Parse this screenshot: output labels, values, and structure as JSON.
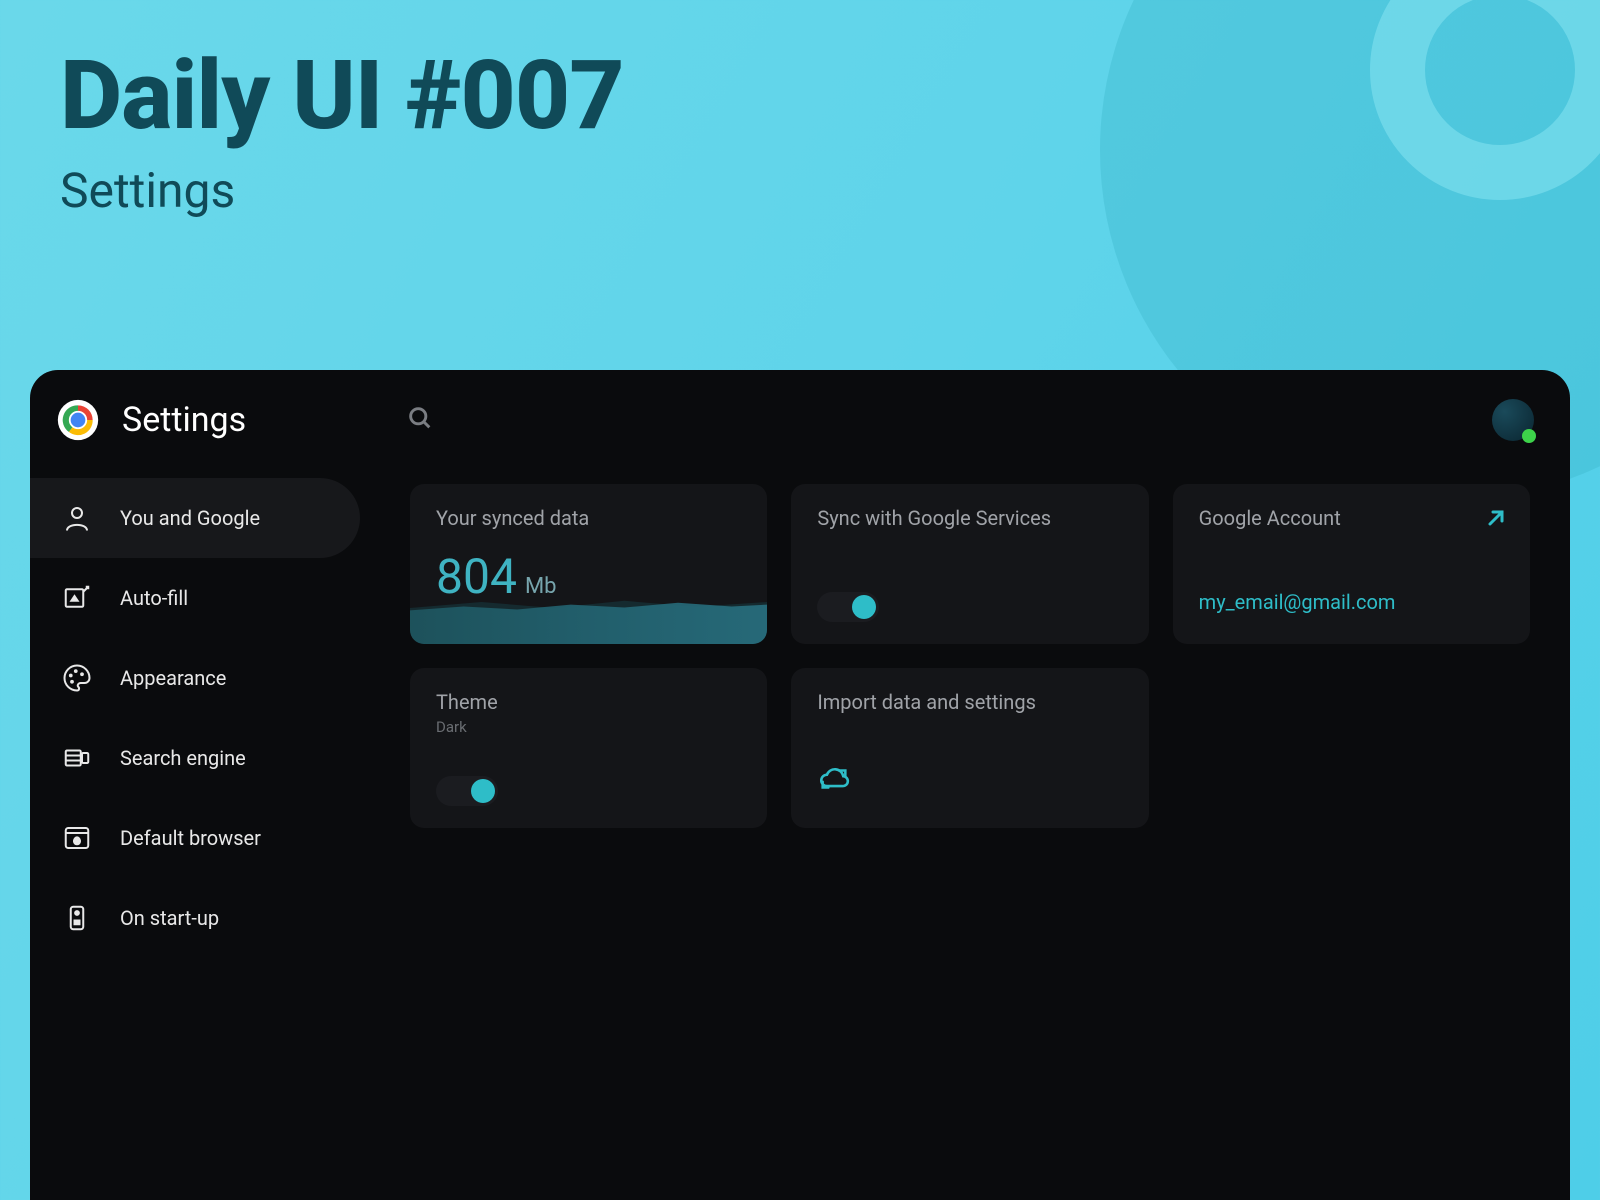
{
  "hero": {
    "title": "Daily UI #007",
    "subtitle": "Settings"
  },
  "topbar": {
    "title": "Settings"
  },
  "sidebar": {
    "items": [
      {
        "label": "You and Google",
        "icon": "person",
        "active": true
      },
      {
        "label": "Auto-fill",
        "icon": "autofill",
        "active": false
      },
      {
        "label": "Appearance",
        "icon": "palette",
        "active": false
      },
      {
        "label": "Search engine",
        "icon": "search-engine",
        "active": false
      },
      {
        "label": "Default browser",
        "icon": "browser",
        "active": false
      },
      {
        "label": "On start-up",
        "icon": "startup",
        "active": false
      }
    ]
  },
  "cards": {
    "synced": {
      "title": "Your synced data",
      "value": "804",
      "unit": "Mb"
    },
    "sync_services": {
      "title": "Sync with Google Services",
      "enabled": true
    },
    "account": {
      "title": "Google Account",
      "email": "my_email@gmail.com"
    },
    "theme": {
      "title": "Theme",
      "value": "Dark",
      "enabled": true
    },
    "import": {
      "title": "Import data and settings"
    }
  }
}
